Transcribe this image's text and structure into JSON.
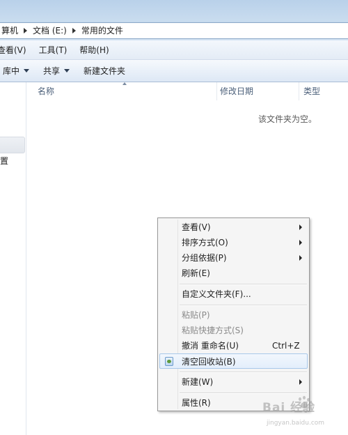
{
  "address": {
    "crumbs": [
      "算机",
      "文档 (E:)",
      "常用的文件"
    ]
  },
  "menubar": {
    "items": [
      "查看(V)",
      "工具(T)",
      "帮助(H)"
    ]
  },
  "toolbar": {
    "include_library": "库中",
    "share": "共享",
    "new_folder": "新建文件夹"
  },
  "nav": {
    "item_label": "置"
  },
  "columns": {
    "name": "名称",
    "modified": "修改日期",
    "type": "类型"
  },
  "content": {
    "empty_message": "该文件夹为空。"
  },
  "context_menu": {
    "view": "查看(V)",
    "sort_by": "排序方式(O)",
    "group_by": "分组依据(P)",
    "refresh": "刷新(E)",
    "customize_folder": "自定义文件夹(F)...",
    "paste": "粘贴(P)",
    "paste_shortcut": "粘贴快捷方式(S)",
    "undo_rename": "撤消 重命名(U)",
    "undo_shortcut": "Ctrl+Z",
    "empty_recycle_bin": "清空回收站(B)",
    "new": "新建(W)",
    "properties": "属性(R)"
  },
  "watermark": {
    "main": "Bai 经验",
    "sub": "jingyan.baidu.com"
  },
  "icons": {
    "recycle_bin": "recycle-bin-icon",
    "submenu": "chevron-right-icon",
    "dropdown": "chevron-down-icon",
    "breadcrumb": "breadcrumb-arrow-icon"
  },
  "colors": {
    "window_frame": "#b9d1ea",
    "toolbar": "#dde8f5",
    "menu_hover_border": "#a8c8ea",
    "disabled_text": "#8a8a8a"
  }
}
